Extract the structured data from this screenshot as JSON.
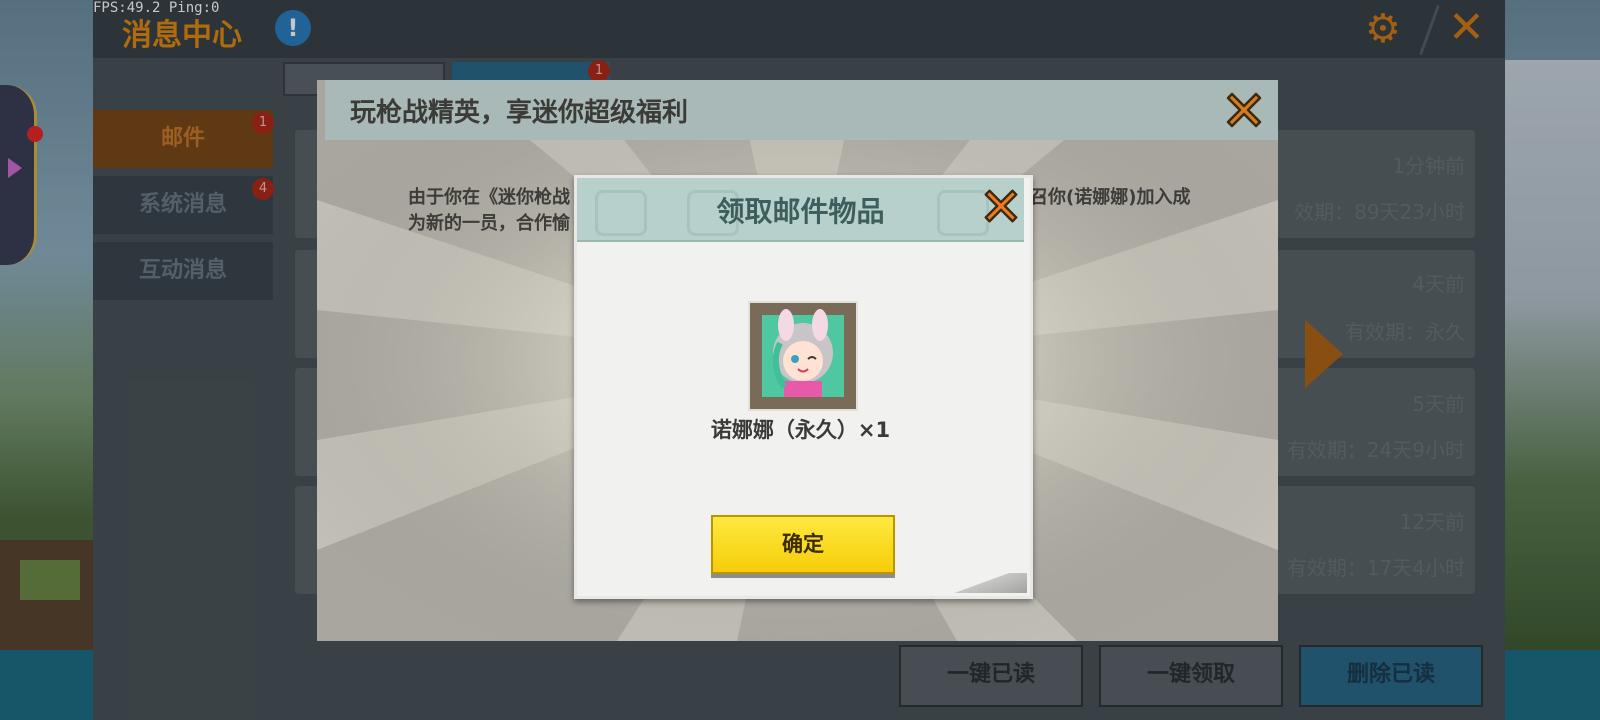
{
  "hud": {
    "fps_text": "FPS:49.2  Ping:0"
  },
  "panel": {
    "title": "消息中心",
    "info_icon": "!",
    "settings_icon": "gear-icon",
    "close_icon": "close-icon",
    "side_tabs": [
      {
        "label": "邮件",
        "badge": "1"
      },
      {
        "label": "系统消息",
        "badge": "4"
      },
      {
        "label": "互动消息"
      }
    ],
    "top_tab_badge": "1",
    "mail_list": [
      {
        "time": "1分钟前",
        "expiry": "效期：89天23小时"
      },
      {
        "time": "4天前",
        "expiry": "有效期：永久"
      },
      {
        "time": "5天前",
        "expiry": "有效期：24天9小时"
      },
      {
        "time": "12天前",
        "expiry": "有效期：17天4小时"
      }
    ],
    "buttons": {
      "read_all": "一键已读",
      "claim_all": "一键领取",
      "delete_read": "删除已读"
    }
  },
  "mail_modal": {
    "title": "玩枪战精英，享迷你超级福利",
    "body_line1": "由于你在《迷你枪战",
    "body_line1_right": "召你(诺娜娜)加入成",
    "body_line2": "为新的一员，合作愉"
  },
  "claim_dialog": {
    "title": "领取邮件物品",
    "item_caption": "诺娜娜（永久）×1",
    "confirm": "确定"
  },
  "colors": {
    "accent_orange": "#e08a10",
    "confirm_yellow": "#f5cd08",
    "dialog_header": "#b8d0cc",
    "badge_red": "#b02a1a"
  }
}
